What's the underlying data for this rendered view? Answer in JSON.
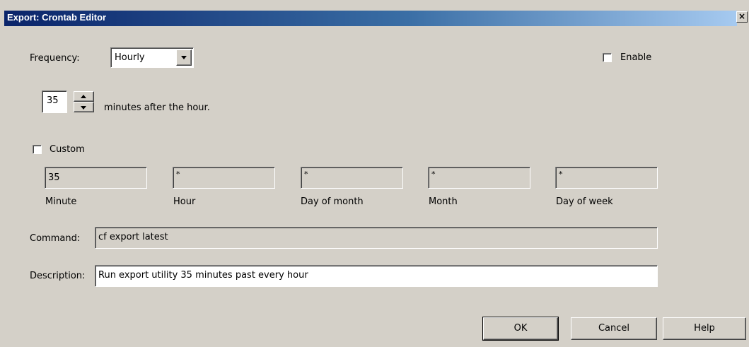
{
  "window": {
    "title": "Export: Crontab Editor",
    "close_glyph": "×"
  },
  "frequency": {
    "label": "Frequency:",
    "selected": "Hourly"
  },
  "enable": {
    "label": "Enable",
    "checked": false
  },
  "minutes": {
    "value": "35",
    "suffix": "minutes after the hour."
  },
  "custom": {
    "label": "Custom",
    "checked": false,
    "fields": [
      {
        "value": "35",
        "label": "Minute"
      },
      {
        "value": "*",
        "label": "Hour"
      },
      {
        "value": "*",
        "label": "Day of month"
      },
      {
        "value": "*",
        "label": "Month"
      },
      {
        "value": "*",
        "label": "Day of week"
      }
    ]
  },
  "command": {
    "label": "Command:",
    "value": "cf export latest"
  },
  "description": {
    "label": "Description:",
    "value": "Run export utility 35 minutes past every hour"
  },
  "buttons": {
    "ok": "OK",
    "cancel": "Cancel",
    "help": "Help"
  },
  "colors": {
    "title_gradient_start": "#0a246a",
    "title_gradient_end": "#a6caf0",
    "dialog_bg": "#d4d0c8"
  },
  "icons": {
    "dropdown": "chevron-down-icon",
    "spin_up": "arrow-up-icon",
    "spin_down": "arrow-down-icon",
    "close": "close-icon"
  }
}
